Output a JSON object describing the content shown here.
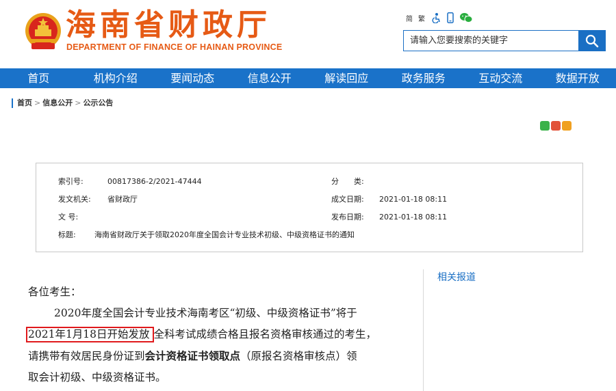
{
  "header": {
    "title": "海南省财政厅",
    "subtitle": "DEPARTMENT OF FINANCE OF HAINAN PROVINCE",
    "tools": {
      "simplified": "简",
      "traditional": "繁",
      "icons": [
        "accessibility-icon",
        "mobile-icon",
        "wechat-icon"
      ]
    },
    "search": {
      "placeholder": "请输入您要搜索的关键字",
      "button_icon": "search-icon"
    }
  },
  "nav": [
    {
      "label": "首页"
    },
    {
      "label": "机构介绍"
    },
    {
      "label": "要闻动态"
    },
    {
      "label": "信息公开"
    },
    {
      "label": "解读回应"
    },
    {
      "label": "政务服务"
    },
    {
      "label": "互动交流"
    },
    {
      "label": "数据开放"
    }
  ],
  "breadcrumb": {
    "items": [
      "首页",
      "信息公开",
      "公示公告"
    ],
    "separator": ">"
  },
  "info": {
    "index_no": {
      "label": "索引号:",
      "value": "00817386-2/2021-47444"
    },
    "category": {
      "label": "分　　类:",
      "value": ""
    },
    "issuer": {
      "label": "发文机关:",
      "value": "省财政厅"
    },
    "created": {
      "label": "成文日期:",
      "value": "2021-01-18 08:11"
    },
    "doc_no": {
      "label": "文  号:",
      "value": ""
    },
    "published": {
      "label": "发布日期:",
      "value": "2021-01-18 08:11"
    },
    "subject": {
      "label": "标题:",
      "value": "海南省财政厅关于领取2020年度全国会计专业技术初级、中级资格证书的通知"
    }
  },
  "article": {
    "greeting": "各位考生：",
    "p1_a": "2020年度全国会计专业技术海南考区“初级、中级资格证书”将于",
    "p1_highlight": "2021年1月18日开始发放",
    "p1_b": "全科考试成绩合格且报名资格审核通过的考生，",
    "p1_c": "请携带有效居民身份证到",
    "p1_bold": "会计资格证书领取点",
    "p1_d": "（原报名资格审核点）领",
    "p1_e": "取会计初级、中级资格证书。"
  },
  "sidebar": {
    "related_label": "相关报道"
  },
  "colors": {
    "brand_orange": "#e65a15",
    "nav_blue": "#1a72c9",
    "highlight_red": "#e0191b"
  }
}
